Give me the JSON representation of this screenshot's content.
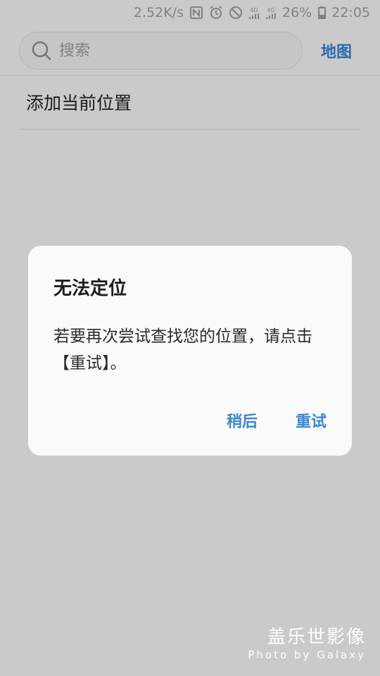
{
  "status_bar": {
    "speed": "2.52K/s",
    "network_1": "4G",
    "network_2": "4G",
    "battery": "26%",
    "time": "22:05"
  },
  "search": {
    "placeholder": "搜索",
    "map_link": "地图"
  },
  "list": {
    "add_location": "添加当前位置"
  },
  "dialog": {
    "title": "无法定位",
    "message": "若要再次尝试查找您的位置，请点击【重试】。",
    "later_button": "稍后",
    "retry_button": "重试"
  },
  "watermark": {
    "title": "盖乐世影像",
    "subtitle": "Photo by Galaxy"
  },
  "colors": {
    "accent": "#2f7fd0",
    "background": "#c9c9c9",
    "dialog_bg": "#fafafa"
  }
}
